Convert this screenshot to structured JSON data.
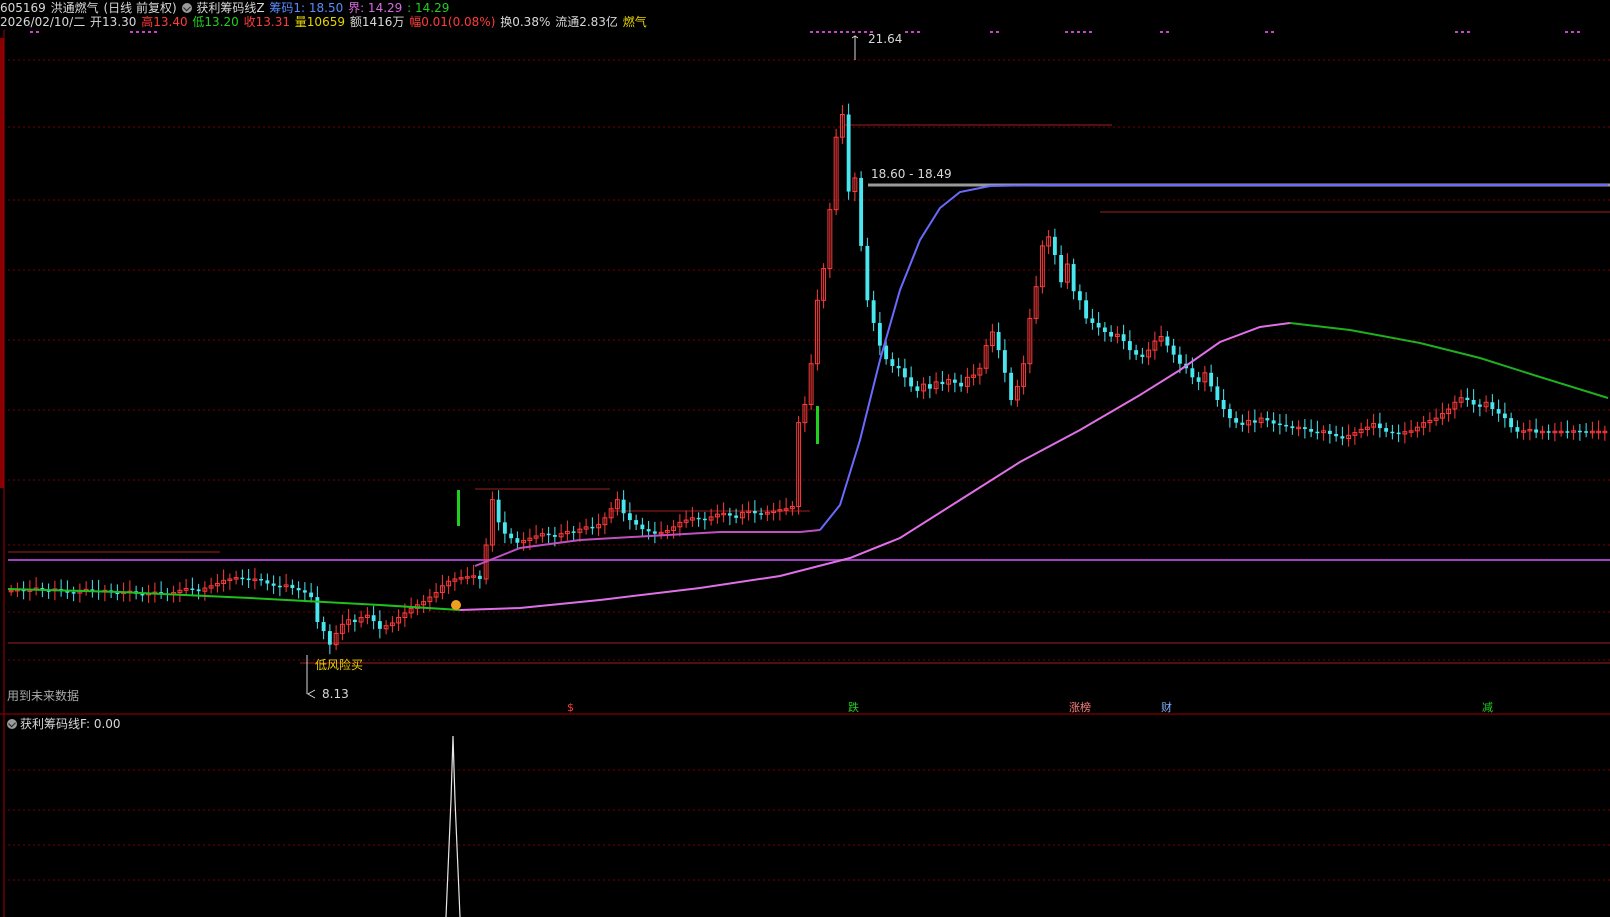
{
  "header": {
    "code": "605169",
    "name": "洪通燃气",
    "period": "(日线 前复权)",
    "indicator_name": "获利筹码线Z",
    "chip1_label": "筹码1: 18.50",
    "bound_label": "界: 14.29",
    "bound2_label": ": 14.29",
    "date": "2026/02/10/二",
    "open": "开13.30",
    "high": "高13.40",
    "low": "低13.20",
    "close": "收13.31",
    "volume": "量10659",
    "amount": "额1416万",
    "change": "幅0.01(0.08%)",
    "turnover": "换0.38%",
    "float_cap": "流通2.83亿",
    "sector": "燃气"
  },
  "labels": {
    "future_data": "用到未来数据",
    "low_risk_buy": "低风险买",
    "high_mark": "21.64",
    "low_mark": "8.13",
    "range_mark": "18.60 - 18.49",
    "sub_title": "获利筹码线F",
    "sub_value": ": 0.00"
  },
  "events": [
    {
      "label": "$",
      "color": "#ff3b3b"
    },
    {
      "label": "跌",
      "color": "#1fd11f"
    },
    {
      "label": "涨榜",
      "color": "#ff8080"
    },
    {
      "label": "财",
      "color": "#7fb0ff"
    },
    {
      "label": "减",
      "color": "#1fd11f"
    }
  ],
  "colors": {
    "up": "#ff3b3b",
    "down": "#49e6f0",
    "grid": "#7a0000",
    "ma_green": "#1fbf1f",
    "ma_magenta": "#e070e8",
    "chip_blue": "#6a6aff",
    "chip_gray": "#9a9a9a"
  },
  "chart_data": {
    "type": "candlestick",
    "price_range": [
      8.13,
      21.64
    ],
    "x": [
      "1",
      "2",
      "3",
      "4",
      "5",
      "6",
      "7",
      "8",
      "9",
      "10",
      "11",
      "12",
      "13",
      "14",
      "15",
      "16",
      "17",
      "18",
      "19",
      "20",
      "21",
      "22",
      "23",
      "24",
      "25",
      "26",
      "27",
      "28",
      "29",
      "30",
      "31",
      "32",
      "33",
      "34",
      "35",
      "36",
      "37",
      "38",
      "39",
      "40",
      "41",
      "42",
      "43",
      "44",
      "45",
      "46",
      "47",
      "48",
      "49",
      "50",
      "51",
      "52",
      "53",
      "54",
      "55",
      "56",
      "57",
      "58",
      "59",
      "60",
      "61",
      "62",
      "63",
      "64",
      "65",
      "66",
      "67",
      "68",
      "69",
      "70",
      "71",
      "72",
      "73",
      "74",
      "75",
      "76",
      "77",
      "78",
      "79",
      "80",
      "81",
      "82",
      "83",
      "84",
      "85",
      "86",
      "87",
      "88",
      "89",
      "90",
      "91",
      "92",
      "93",
      "94",
      "95",
      "96",
      "97",
      "98",
      "99",
      "100",
      "101",
      "102",
      "103",
      "104",
      "105",
      "106",
      "107",
      "108",
      "109",
      "110",
      "111",
      "112",
      "113",
      "114",
      "115",
      "116",
      "117",
      "118",
      "119",
      "120",
      "121",
      "122",
      "123",
      "124",
      "125",
      "126",
      "127",
      "128",
      "129",
      "130",
      "131",
      "132",
      "133",
      "134",
      "135",
      "136",
      "137",
      "138",
      "139",
      "140",
      "141",
      "142",
      "143",
      "144",
      "145",
      "146",
      "147",
      "148",
      "149",
      "150",
      "151",
      "152",
      "153",
      "154",
      "155",
      "156",
      "157",
      "158",
      "159",
      "160",
      "161",
      "162",
      "163",
      "164",
      "165",
      "166",
      "167",
      "168",
      "169",
      "170",
      "171",
      "172",
      "173",
      "174",
      "175",
      "176",
      "177",
      "178",
      "179",
      "180",
      "181",
      "182",
      "183",
      "184",
      "185",
      "186",
      "187",
      "188",
      "189",
      "190",
      "191",
      "192",
      "193",
      "194",
      "195",
      "196",
      "197",
      "198",
      "199",
      "200",
      "201",
      "202",
      "203",
      "204",
      "205",
      "206",
      "207",
      "208",
      "209",
      "210",
      "211",
      "212",
      "213",
      "214",
      "215",
      "216",
      "217",
      "218",
      "219",
      "220",
      "221",
      "222",
      "223",
      "224",
      "225",
      "226",
      "227",
      "228",
      "229",
      "230",
      "231",
      "232",
      "233",
      "234",
      "235",
      "236",
      "237",
      "238",
      "239",
      "240",
      "241",
      "242",
      "243",
      "244",
      "245",
      "246",
      "247",
      "248",
      "249",
      "250",
      "251",
      "252",
      "253",
      "254",
      "255",
      "256"
    ],
    "close": [
      9.8,
      9.82,
      9.78,
      9.81,
      9.85,
      9.8,
      9.79,
      9.83,
      9.78,
      9.76,
      9.74,
      9.8,
      9.82,
      9.79,
      9.77,
      9.8,
      9.75,
      9.73,
      9.76,
      9.78,
      9.72,
      9.7,
      9.74,
      9.76,
      9.73,
      9.71,
      9.75,
      9.8,
      9.84,
      9.82,
      9.78,
      9.85,
      9.9,
      9.95,
      10.02,
      10.05,
      10.08,
      10.06,
      10.03,
      10.05,
      10.02,
      9.95,
      9.9,
      9.88,
      9.92,
      9.85,
      9.8,
      9.75,
      9.65,
      9.1,
      8.9,
      8.6,
      8.85,
      9.05,
      9.15,
      9.1,
      9.2,
      9.25,
      9.12,
      8.95,
      9.02,
      9.08,
      9.2,
      9.3,
      9.4,
      9.48,
      9.55,
      9.65,
      9.75,
      9.9,
      10.0,
      10.05,
      10.08,
      10.1,
      10.12,
      10.05,
      10.8,
      11.8,
      11.3,
      11.05,
      10.95,
      10.85,
      10.9,
      10.95,
      11.0,
      11.05,
      11.02,
      10.98,
      11.05,
      11.1,
      11.08,
      11.15,
      11.2,
      11.18,
      11.25,
      11.4,
      11.6,
      11.8,
      11.5,
      11.35,
      11.25,
      11.15,
      11.1,
      11.05,
      11.08,
      11.12,
      11.2,
      11.3,
      11.35,
      11.4,
      11.38,
      11.35,
      11.42,
      11.48,
      11.5,
      11.45,
      11.4,
      11.52,
      11.55,
      11.5,
      11.48,
      11.52,
      11.55,
      11.58,
      11.6,
      11.65,
      13.5,
      13.9,
      14.8,
      16.2,
      16.9,
      18.2,
      19.8,
      20.3,
      18.6,
      18.9,
      17.4,
      16.2,
      15.7,
      15.2,
      14.9,
      14.75,
      14.7,
      14.5,
      14.3,
      14.2,
      14.35,
      14.25,
      14.4,
      14.35,
      14.45,
      14.38,
      14.3,
      14.5,
      14.55,
      14.7,
      15.2,
      15.5,
      15.1,
      14.6,
      14.0,
      14.3,
      14.8,
      15.8,
      16.5,
      17.4,
      17.6,
      17.2,
      16.6,
      17.0,
      16.4,
      16.2,
      15.8,
      15.7,
      15.6,
      15.5,
      15.4,
      15.45,
      15.3,
      15.1,
      15.0,
      14.95,
      15.1,
      15.3,
      15.4,
      15.2,
      15.0,
      14.8,
      14.7,
      14.5,
      14.4,
      14.6,
      14.3,
      14.0,
      13.8,
      13.6,
      13.5,
      13.45,
      13.55,
      13.5,
      13.6,
      13.55,
      13.48,
      13.45,
      13.42,
      13.38,
      13.4,
      13.36,
      13.3,
      13.28,
      13.32,
      13.25,
      13.2,
      13.15,
      13.22,
      13.28,
      13.35,
      13.4,
      13.48,
      13.38,
      13.3,
      13.28,
      13.25,
      13.3,
      13.32,
      13.4,
      13.5,
      13.55,
      13.6,
      13.7,
      13.8,
      13.95,
      14.05,
      14.0,
      13.9,
      13.85,
      13.95,
      13.8,
      13.7,
      13.6,
      13.4,
      13.3,
      13.32,
      13.35,
      13.28,
      13.31,
      13.3,
      13.31,
      13.31,
      13.3,
      13.32,
      13.31,
      13.3,
      13.31,
      13.31,
      13.31
    ],
    "ma_green": [
      9.95,
      9.9,
      9.85,
      9.8,
      9.78,
      9.75
    ],
    "series": [
      {
        "name": "获利筹码线Z"
      },
      {
        "name": "获利筹码线F"
      }
    ]
  }
}
